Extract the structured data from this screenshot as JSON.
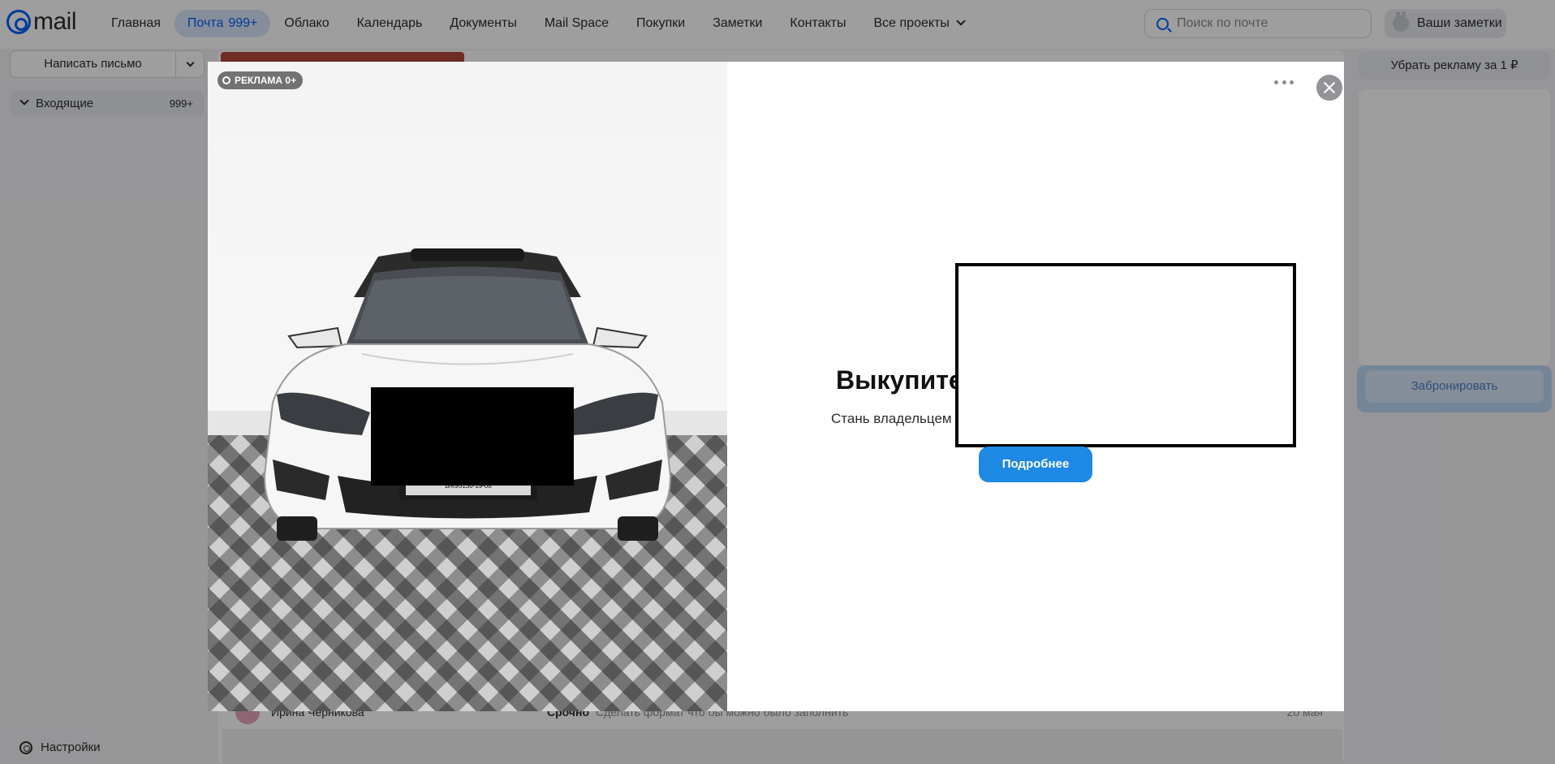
{
  "header": {
    "logo_text": "mail",
    "nav": [
      {
        "label": "Главная"
      },
      {
        "label": "Почта",
        "count": "999+",
        "active": true
      },
      {
        "label": "Облако"
      },
      {
        "label": "Календарь"
      },
      {
        "label": "Документы"
      },
      {
        "label": "Mail Space"
      },
      {
        "label": "Покупки"
      },
      {
        "label": "Заметки"
      },
      {
        "label": "Контакты"
      },
      {
        "label": "Все проекты"
      }
    ],
    "search_placeholder": "Поиск по почте",
    "notes_button": "Ваши заметки"
  },
  "sidebar": {
    "compose_label": "Написать письмо",
    "folder_label": "Входящие",
    "folder_count": "999+",
    "settings_label": "Настройки"
  },
  "right": {
    "remove_ad_label": "Убрать рекламу за 1 ₽",
    "book_label": "Забронировать"
  },
  "mail_row": {
    "sender": "Ирина Черникова",
    "subject": "Срочно",
    "snippet": "Сделать формат что бы можно было заполнить",
    "date": "20 мая"
  },
  "modal": {
    "badge": "РЕКЛАМА 0+",
    "headline": "Выкупите",
    "subline": "Стань владельцем",
    "cta": "Подробнее",
    "plate_text": "В/К95130-19-08"
  },
  "colors": {
    "accent": "#005ff9",
    "cta": "#1e88e5"
  }
}
